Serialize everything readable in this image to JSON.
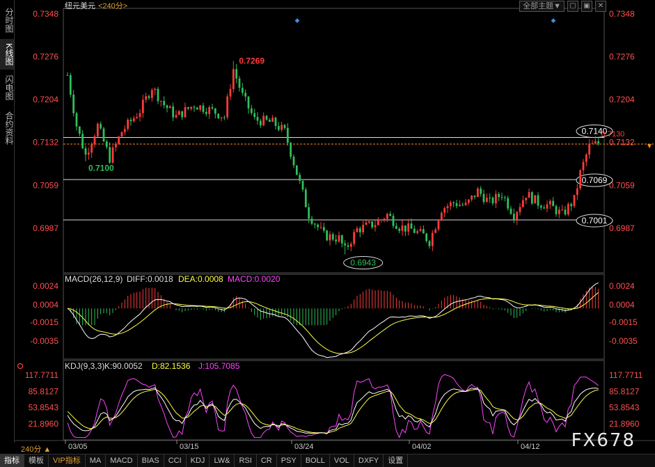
{
  "left_tabs": [
    {
      "label": "分时图",
      "active": false
    },
    {
      "label": "K线图",
      "active": true
    },
    {
      "label": "闪电图",
      "active": false
    },
    {
      "label": "合约资料",
      "active": false
    }
  ],
  "header": {
    "instrument": "纽元美元",
    "period": "<240分>",
    "theme_button": "全部主题▼"
  },
  "price_axis_labels": [
    "0.7348",
    "0.7276",
    "0.7204",
    "0.7132",
    "0.7059",
    "0.6987"
  ],
  "annotations": {
    "high": "0.7269",
    "low_left": "0.7100",
    "low_main": "0.6943",
    "current": "0.7130",
    "level_1": "0.7140",
    "level_2": "0.7069",
    "level_3": "0.7001"
  },
  "macd": {
    "title": "MACD(26,12,9)",
    "diff": "DIFF:0.0018",
    "dea": "DEA:0.0008",
    "macd": "MACD:0.0020",
    "axis_labels": [
      "0.0024",
      "0.0004",
      "-0.0015",
      "-0.0035"
    ]
  },
  "kdj": {
    "title": "KDJ(9,3,3)",
    "k": "K:90.0052",
    "d": "D:82.1536",
    "j": "J:105.7085",
    "axis_labels": [
      "117.7711",
      "85.8127",
      "53.8543",
      "21.8960"
    ]
  },
  "date_labels": [
    "03/05",
    "03/15",
    "03/24",
    "04/02",
    "04/12"
  ],
  "period_selector": "240分 ▲",
  "bottom_tabs": [
    "指标",
    "模板",
    "VIP指标",
    "MA",
    "MACD",
    "BIAS",
    "CCI",
    "KDJ",
    "LW&",
    "RSI",
    "CR",
    "PSY",
    "BOLL",
    "VOL",
    "DXFY",
    "设置"
  ],
  "watermark": "FX678",
  "colors": {
    "up": "#ff3b3b",
    "down": "#2fbf5a",
    "dea": "#ffff44",
    "macd_text": "#ff44ff",
    "price_label": "#ff5050",
    "period": "#e0a030"
  },
  "chart_data": {
    "type": "candlestick",
    "price_ylim": [
      0.693,
      0.735
    ],
    "levels": [
      0.714,
      0.7069,
      0.7001
    ],
    "current_price": 0.713,
    "anchors": [
      {
        "i": 0,
        "p": 0.7245
      },
      {
        "i": 3,
        "p": 0.716
      },
      {
        "i": 6,
        "p": 0.711
      },
      {
        "i": 10,
        "p": 0.716
      },
      {
        "i": 14,
        "p": 0.7105
      },
      {
        "i": 18,
        "p": 0.715
      },
      {
        "i": 24,
        "p": 0.7185
      },
      {
        "i": 28,
        "p": 0.7225
      },
      {
        "i": 32,
        "p": 0.7195
      },
      {
        "i": 36,
        "p": 0.7175
      },
      {
        "i": 42,
        "p": 0.7195
      },
      {
        "i": 48,
        "p": 0.7185
      },
      {
        "i": 52,
        "p": 0.7175
      },
      {
        "i": 55,
        "p": 0.7255
      },
      {
        "i": 58,
        "p": 0.721
      },
      {
        "i": 62,
        "p": 0.717
      },
      {
        "i": 68,
        "p": 0.7165
      },
      {
        "i": 72,
        "p": 0.715
      },
      {
        "i": 76,
        "p": 0.708
      },
      {
        "i": 80,
        "p": 0.701
      },
      {
        "i": 85,
        "p": 0.6975
      },
      {
        "i": 90,
        "p": 0.697
      },
      {
        "i": 92,
        "p": 0.695
      },
      {
        "i": 96,
        "p": 0.6985
      },
      {
        "i": 102,
        "p": 0.6995
      },
      {
        "i": 106,
        "p": 0.701
      },
      {
        "i": 110,
        "p": 0.699
      },
      {
        "i": 114,
        "p": 0.6985
      },
      {
        "i": 118,
        "p": 0.6975
      },
      {
        "i": 120,
        "p": 0.6965
      },
      {
        "i": 124,
        "p": 0.702
      },
      {
        "i": 128,
        "p": 0.703
      },
      {
        "i": 132,
        "p": 0.7025
      },
      {
        "i": 136,
        "p": 0.705
      },
      {
        "i": 140,
        "p": 0.703
      },
      {
        "i": 144,
        "p": 0.7045
      },
      {
        "i": 148,
        "p": 0.701
      },
      {
        "i": 152,
        "p": 0.7045
      },
      {
        "i": 156,
        "p": 0.703
      },
      {
        "i": 160,
        "p": 0.7025
      },
      {
        "i": 164,
        "p": 0.701
      },
      {
        "i": 168,
        "p": 0.7035
      },
      {
        "i": 170,
        "p": 0.708
      },
      {
        "i": 173,
        "p": 0.7125
      },
      {
        "i": 176,
        "p": 0.713
      }
    ],
    "bar_count": 177
  }
}
